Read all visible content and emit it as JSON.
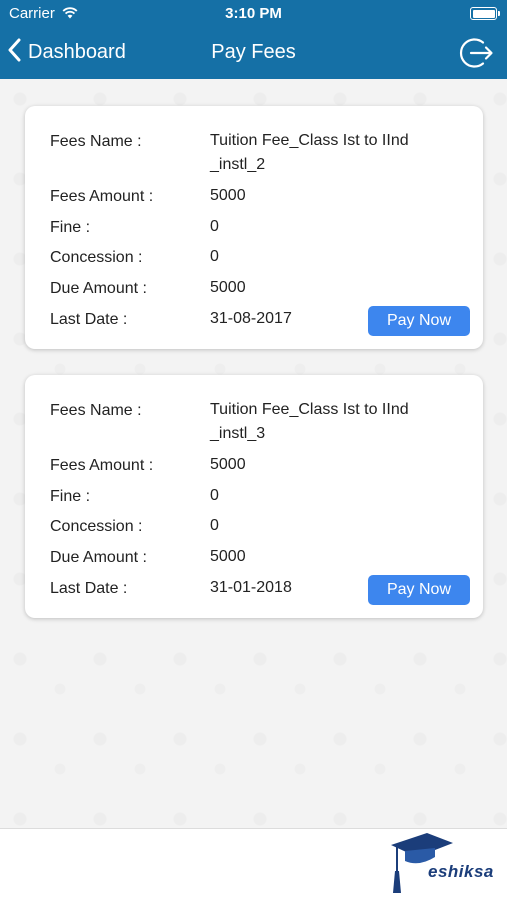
{
  "status_bar": {
    "carrier": "Carrier",
    "time": "3:10 PM",
    "wifi_icon": "wifi-icon",
    "battery_icon": "battery-icon"
  },
  "nav": {
    "back_label": "Dashboard",
    "title": "Pay Fees",
    "logout_icon": "logout-icon",
    "bar_color": "#1570a6"
  },
  "labels": {
    "fees_name": "Fees Name :",
    "fees_amount": "Fees Amount :",
    "fine": "Fine :",
    "concession": "Concession :",
    "due_amount": "Due Amount :",
    "last_date": "Last Date :"
  },
  "fees": [
    {
      "name_line1": "Tuition Fee_Class Ist to IInd",
      "name_line2": "_instl_2",
      "amount": "5000",
      "fine": "0",
      "concession": "0",
      "due_amount": "5000",
      "last_date": "31-08-2017",
      "button": "Pay Now"
    },
    {
      "name_line1": "Tuition Fee_Class Ist to IInd",
      "name_line2": "_instl_3",
      "amount": "5000",
      "fine": "0",
      "concession": "0",
      "due_amount": "5000",
      "last_date": "31-01-2018",
      "button": "Pay Now"
    }
  ],
  "footer": {
    "logo_text": "eshiksa",
    "logo_icon": "graduation-cap-icon"
  },
  "colors": {
    "button": "#3d86ee",
    "brand": "#1b3d7a"
  }
}
